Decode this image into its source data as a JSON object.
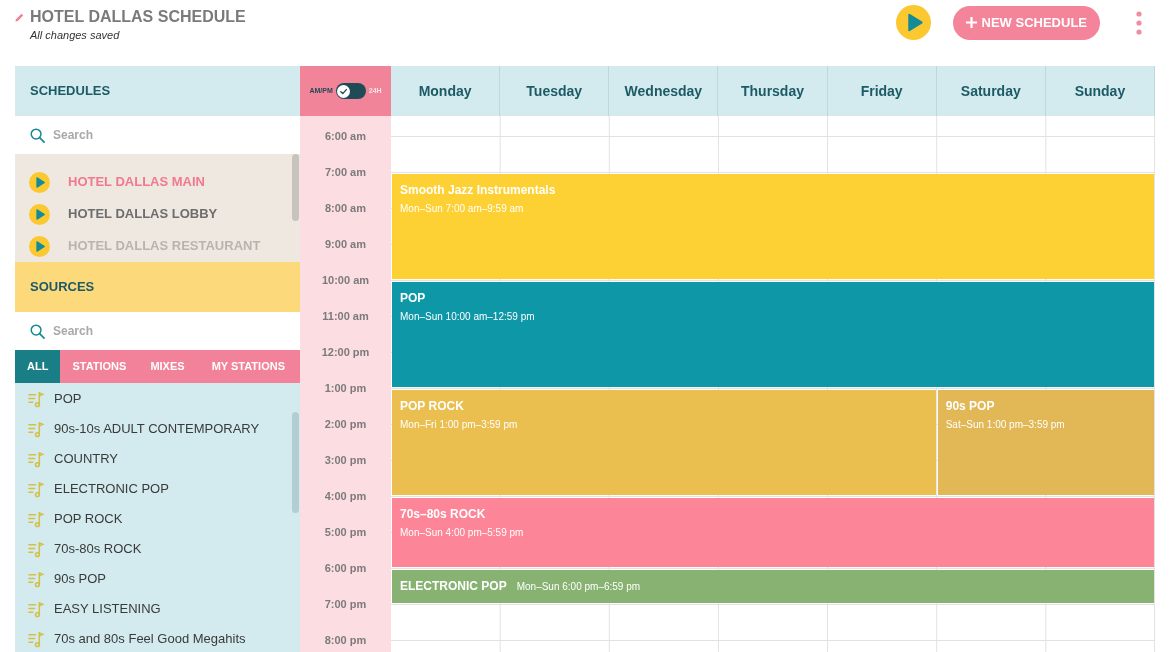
{
  "header": {
    "title": "HOTEL DALLAS SCHEDULE",
    "status": "All changes saved",
    "new_button": "NEW SCHEDULE"
  },
  "schedules": {
    "heading": "SCHEDULES",
    "search": {
      "placeholder": "Search"
    },
    "items": [
      {
        "name": "HOTEL DALLAS MAIN",
        "selected": true,
        "disabled": false
      },
      {
        "name": "HOTEL DALLAS LOBBY",
        "selected": false,
        "disabled": false
      },
      {
        "name": "HOTEL DALLAS RESTAURANT",
        "selected": false,
        "disabled": true
      }
    ]
  },
  "sources": {
    "heading": "SOURCES",
    "search": {
      "placeholder": "Search"
    },
    "tabs": [
      {
        "label": "ALL",
        "selected": true
      },
      {
        "label": "STATIONS",
        "selected": false
      },
      {
        "label": "MIXES",
        "selected": false
      },
      {
        "label": "MY STATIONS",
        "selected": false
      }
    ],
    "items": [
      "POP",
      "90s-10s ADULT CONTEMPORARY",
      "COUNTRY",
      "ELECTRONIC POP",
      "POP ROCK",
      "70s-80s ROCK",
      "90s POP",
      "EASY LISTENING",
      "70s and 80s Feel Good Megahits"
    ]
  },
  "time_format": {
    "left_label": "AM/PM",
    "right_label": "24H",
    "on": false
  },
  "times": [
    "6:00 am",
    "7:00 am",
    "8:00 am",
    "9:00 am",
    "10:00 am",
    "11:00 am",
    "12:00 pm",
    "1:00 pm",
    "2:00 pm",
    "3:00 pm",
    "4:00 pm",
    "5:00 pm",
    "6:00 pm",
    "7:00 pm",
    "8:00 pm"
  ],
  "calendar": {
    "days": [
      "Monday",
      "Tuesday",
      "Wednesday",
      "Thursday",
      "Friday",
      "Saturday",
      "Sunday"
    ],
    "events": [
      {
        "kind": "block",
        "title": "Smooth Jazz Instrumentals",
        "time": "Mon–Sun 7:00 am–9:59 am",
        "color": "#fdd033"
      },
      {
        "kind": "block",
        "title": "POP",
        "time": "Mon–Sun 10:00 am–12:59 pm",
        "color": "#0d97a7"
      },
      {
        "kind": "block",
        "title": "POP ROCK",
        "time": "Mon–Fri 1:00 pm–3:59 pm",
        "color": "#ebbe50"
      },
      {
        "kind": "block",
        "title": "90s POP",
        "time": "Sat–Sun 1:00 pm–3:59 pm",
        "color": "#e2b755"
      },
      {
        "kind": "block",
        "title": "70s–80s ROCK",
        "time": "Mon–Sun 4:00 pm–5:59 pm",
        "color": "#fd8598"
      },
      {
        "kind": "strip",
        "title": "ELECTRONIC POP",
        "time": "Mon–Sun 6:00 pm–6:59 pm",
        "color": "#87b272"
      }
    ]
  }
}
